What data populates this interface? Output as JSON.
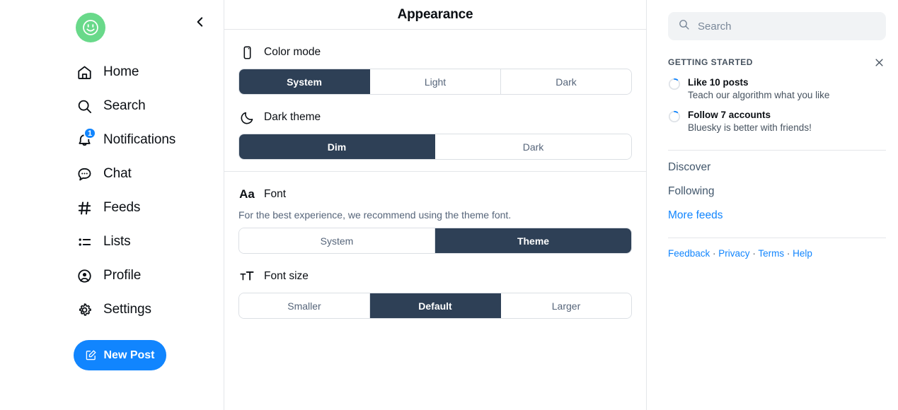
{
  "theme": {
    "accent": "#1185fe",
    "selected_segment_bg": "#2e4056",
    "avatar_bg": "#69d98a",
    "border": "#e4e6e9",
    "search_bg": "#f1f3f5",
    "muted_text": "#56657a"
  },
  "sidebar": {
    "avatar_alt": "avatar",
    "collapse_label": "",
    "items": [
      {
        "label": "Home",
        "icon": "home-icon",
        "badge": ""
      },
      {
        "label": "Search",
        "icon": "search-icon",
        "badge": ""
      },
      {
        "label": "Notifications",
        "icon": "bell-icon",
        "badge": "1"
      },
      {
        "label": "Chat",
        "icon": "chat-bubble-icon",
        "badge": ""
      },
      {
        "label": "Feeds",
        "icon": "hashtag-icon",
        "badge": ""
      },
      {
        "label": "Lists",
        "icon": "list-icon",
        "badge": ""
      },
      {
        "label": "Profile",
        "icon": "user-circle-icon",
        "badge": ""
      },
      {
        "label": "Settings",
        "icon": "gear-icon",
        "badge": ""
      }
    ],
    "new_post_label": "New Post"
  },
  "main": {
    "title": "Appearance",
    "settings": [
      {
        "key": "color_mode",
        "label": "Color mode",
        "icon": "phone-icon",
        "description": "",
        "options": [
          "System",
          "Light",
          "Dark"
        ],
        "selected": "System"
      },
      {
        "key": "dark_theme",
        "label": "Dark theme",
        "icon": "moon-icon",
        "description": "",
        "options": [
          "Dim",
          "Dark"
        ],
        "selected": "Dim"
      },
      {
        "key": "font",
        "label": "Font",
        "icon": "Aa",
        "description": "For the best experience, we recommend using the theme font.",
        "options": [
          "System",
          "Theme"
        ],
        "selected": "Theme"
      },
      {
        "key": "font_size",
        "label": "Font size",
        "icon": "font-size-icon",
        "description": "",
        "options": [
          "Smaller",
          "Default",
          "Larger"
        ],
        "selected": "Default"
      }
    ]
  },
  "right": {
    "search": {
      "placeholder": "Search",
      "value": ""
    },
    "getting_started": {
      "title": "GETTING STARTED",
      "close_label": "",
      "items": [
        {
          "title": "Like 10 posts",
          "subtitle": "Teach our algorithm what you like",
          "progress": 10
        },
        {
          "title": "Follow 7 accounts",
          "subtitle": "Bluesky is better with friends!",
          "progress": 10
        }
      ]
    },
    "feeds": [
      {
        "label": "Discover",
        "style": "normal"
      },
      {
        "label": "Following",
        "style": "normal"
      },
      {
        "label": "More feeds",
        "style": "link"
      }
    ],
    "footer": {
      "feedback": "Feedback",
      "privacy": "Privacy",
      "terms": "Terms",
      "help": "Help",
      "separator": " · "
    }
  }
}
